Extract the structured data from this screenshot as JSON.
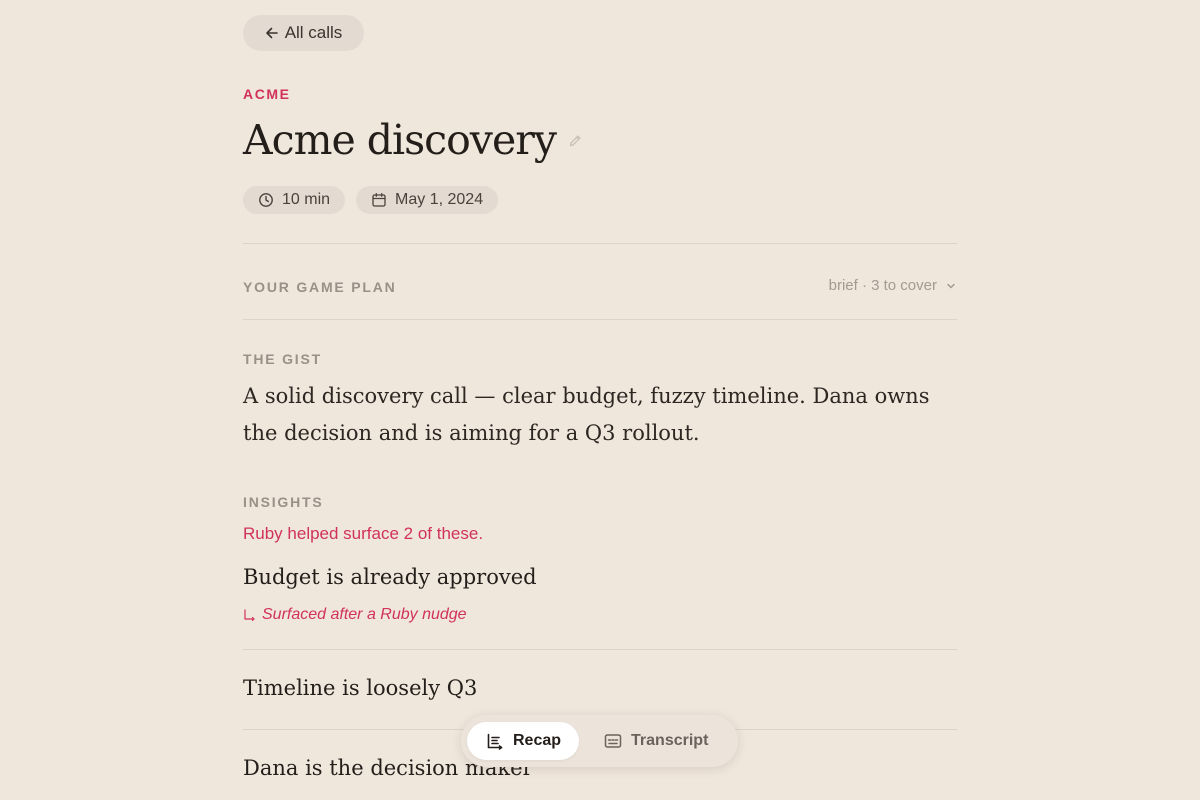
{
  "nav": {
    "back_label": "All calls"
  },
  "call": {
    "company": "ACME",
    "title": "Acme discovery",
    "duration": "10 min",
    "date": "May 1, 2024"
  },
  "game_plan": {
    "label": "YOUR GAME PLAN",
    "toggle_label": "brief · 3 to cover"
  },
  "gist": {
    "label": "THE GIST",
    "text": "A solid discovery call — clear budget, fuzzy timeline. Dana owns the decision and is aiming for a Q3 rollout."
  },
  "insights": {
    "label": "INSIGHTS",
    "ruby_note": "Ruby helped surface 2 of these.",
    "items": [
      {
        "title": "Budget is already approved",
        "subtitle": "Surfaced after a Ruby nudge"
      },
      {
        "title": "Timeline is loosely Q3"
      },
      {
        "title": "Dana is the decision maker"
      }
    ]
  },
  "view_switch": {
    "tabs": [
      {
        "label": "Recap",
        "active": true,
        "icon": "recap-list-icon"
      },
      {
        "label": "Transcript",
        "active": false,
        "icon": "transcript-icon"
      }
    ]
  },
  "colors": {
    "background": "#efe6dc",
    "accent": "#d1325a",
    "chip": "#e3dbd2",
    "muted": "#9a9088"
  }
}
